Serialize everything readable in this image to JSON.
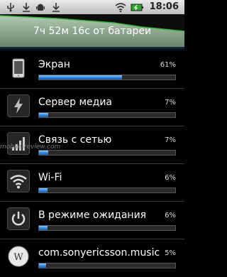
{
  "status_bar": {
    "time": "18:06",
    "icons": [
      "usb-debug-icon",
      "download-icon",
      "android-icon",
      "wifi-icon",
      "battery-icon"
    ]
  },
  "battery_header": {
    "summary": "7ч 52м 16с от батареи"
  },
  "items": [
    {
      "label": "Экран",
      "percent_text": "61%",
      "percent": 61,
      "icon": "screen-icon"
    },
    {
      "label": "Сервер медиа",
      "percent_text": "7%",
      "percent": 7,
      "icon": "lightning-icon"
    },
    {
      "label": "Связь с сетью",
      "percent_text": "7%",
      "percent": 7,
      "icon": "cell-signal-icon"
    },
    {
      "label": "Wi-Fi",
      "percent_text": "6%",
      "percent": 6,
      "icon": "wifi-icon"
    },
    {
      "label": "В режиме ожидания",
      "percent_text": "6%",
      "percent": 6,
      "icon": "power-icon"
    },
    {
      "label": "com.sonyericsson.music",
      "percent_text": "5%",
      "percent": 5,
      "icon": "wikipedia-icon"
    }
  ],
  "watermark": "mobile-review.com",
  "colors": {
    "bar_fill": "#2a7fd8",
    "graph_line": "#38b638",
    "background": "#000000"
  }
}
